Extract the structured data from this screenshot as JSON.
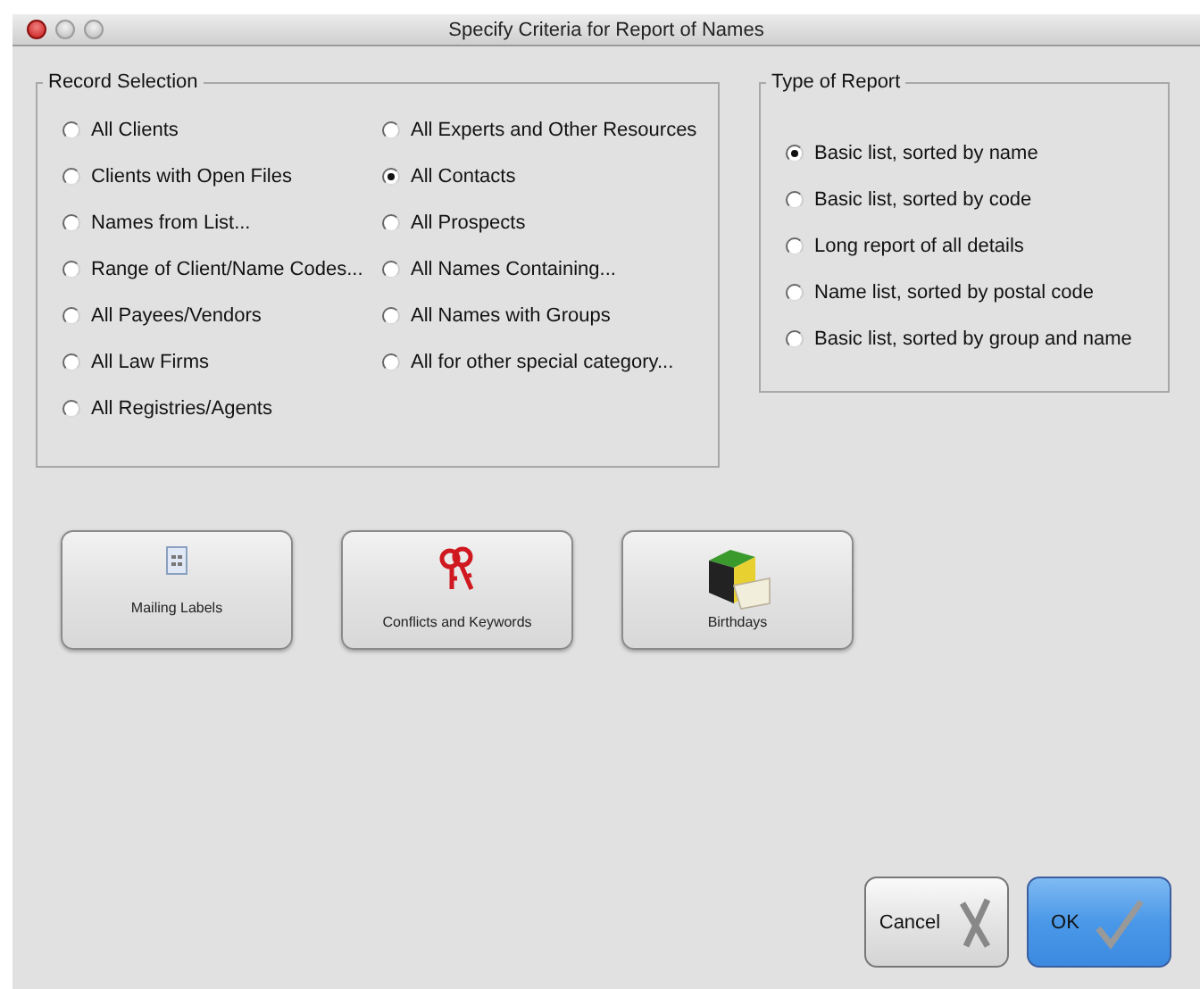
{
  "window": {
    "title": "Specify Criteria for Report of Names"
  },
  "record_selection": {
    "title": "Record Selection",
    "columns": [
      [
        {
          "label": "All Clients",
          "selected": false
        },
        {
          "label": "Clients with Open Files",
          "selected": false
        },
        {
          "label": "Names from List...",
          "selected": false
        },
        {
          "label": "Range of Client/Name Codes...",
          "selected": false
        },
        {
          "label": "All Payees/Vendors",
          "selected": false
        },
        {
          "label": "All Law Firms",
          "selected": false
        },
        {
          "label": "All Registries/Agents",
          "selected": false
        }
      ],
      [
        {
          "label": "All Experts and Other Resources",
          "selected": false
        },
        {
          "label": "All Contacts",
          "selected": true
        },
        {
          "label": "All Prospects",
          "selected": false
        },
        {
          "label": "All Names Containing...",
          "selected": false
        },
        {
          "label": "All Names with Groups",
          "selected": false
        },
        {
          "label": "All for other special category...",
          "selected": false
        }
      ]
    ]
  },
  "type_of_report": {
    "title": "Type of Report",
    "options": [
      {
        "label": "Basic list, sorted by name",
        "selected": true
      },
      {
        "label": "Basic list, sorted by code",
        "selected": false
      },
      {
        "label": "Long report of all details",
        "selected": false
      },
      {
        "label": "Name list, sorted by postal code",
        "selected": false
      },
      {
        "label": "Basic list, sorted by group and name",
        "selected": false
      }
    ]
  },
  "report_buttons": [
    "Mailing Labels",
    "Conflicts and Keywords",
    "Birthdays"
  ],
  "buttons": [
    {
      "label": "Cancel",
      "default": false
    },
    {
      "label": "OK",
      "default": true
    }
  ]
}
